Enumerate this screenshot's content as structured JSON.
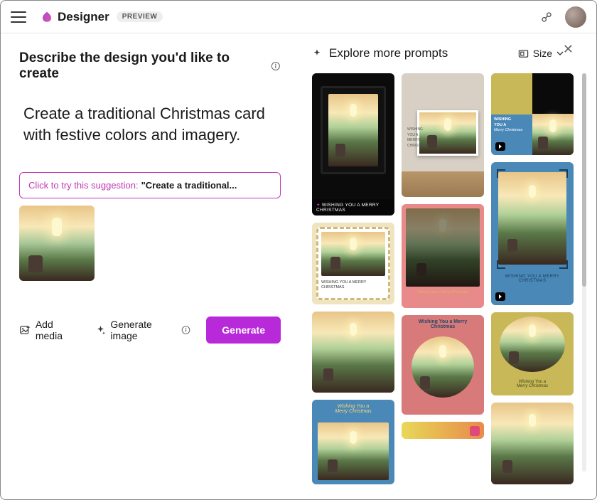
{
  "header": {
    "app_name": "Designer",
    "badge": "PREVIEW"
  },
  "left": {
    "title": "Describe the design you'd like to create",
    "prompt": "Create a traditional Christmas card with festive colors and imagery.",
    "suggestion_label": "Click to try this suggestion: ",
    "suggestion_text": "\"Create a traditional...",
    "add_media": "Add media",
    "generate_image": "Generate image",
    "generate_btn": "Generate"
  },
  "right": {
    "explore": "Explore more prompts",
    "size": "Size",
    "cards": {
      "c1_caption": "WISHING YOU A MERRY CHRISTMAS",
      "c2_l1": "WISHING",
      "c2_l2": "YOU A",
      "c2_l3": "MERRY",
      "c2_l4": "CHRISTMAS",
      "c3_l1": "WISHING",
      "c3_l2": "YOU A",
      "c3_l3": "Merry Christmas",
      "c5_l1": "WISHING YOU A MERRY",
      "c5_l2": "CHRISTMAS",
      "c6_caption": "Wishing You a Merry Christmas",
      "c7_l1": "WISHING YOU A MERRY",
      "c7_l2": "CHRISTMAS",
      "c8_l1": "Wishing You a",
      "c8_l2": "Merry Christmas",
      "c9_l1": "Wishing You a Merry",
      "c9_l2": "Christmas",
      "c10_l1": "Wishing You a",
      "c10_l2": "Merry Christmas"
    }
  }
}
